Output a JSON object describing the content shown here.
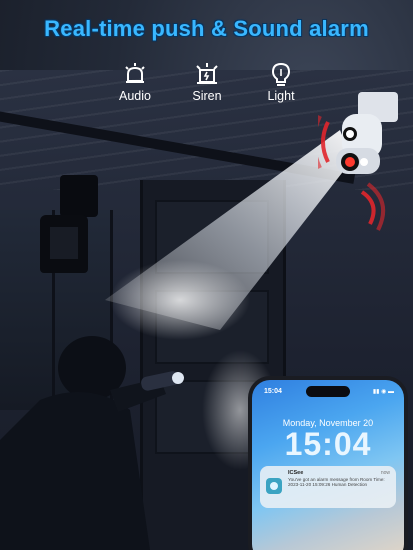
{
  "headline": "Real-time push & Sound alarm",
  "features": [
    {
      "icon": "alarm-bell-icon",
      "label": "Audio"
    },
    {
      "icon": "siren-icon",
      "label": "Siren"
    },
    {
      "icon": "light-bulb-icon",
      "label": "Light"
    }
  ],
  "phone": {
    "status_time": "15:04",
    "status_icons": "▮▮ ◉ ▬",
    "date": "Monday, November 20",
    "clock": "15:04",
    "notification": {
      "app": "ICSee",
      "time": "now",
      "message": "You've got an alarm message from Room Time: 2023-11-20 15:09:26 Human Detection"
    }
  },
  "colors": {
    "headline": "#39b7ff",
    "alarm_waves": "#e0262c",
    "camera_led": "#ff3a2e"
  }
}
